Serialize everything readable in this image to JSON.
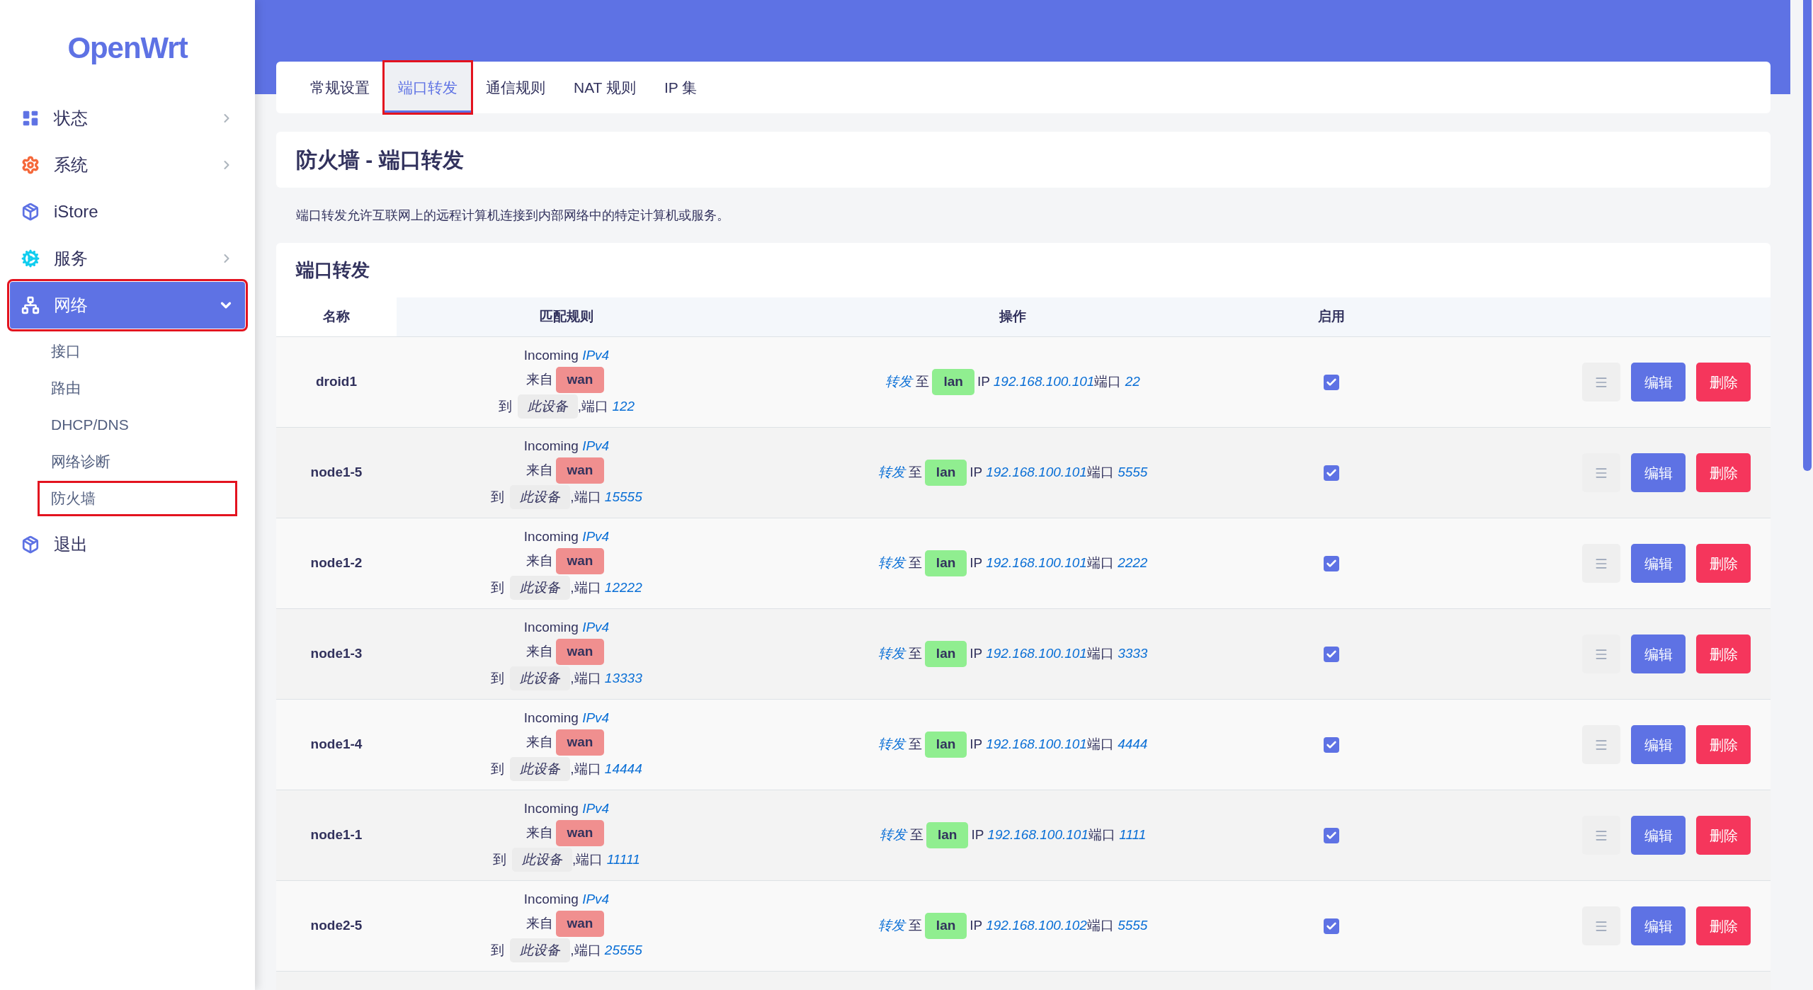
{
  "logo": "OpenWrt",
  "sidebar": {
    "items": [
      {
        "label": "状态",
        "has_arrow": true,
        "expanded": false,
        "selected": false,
        "annotated": false
      },
      {
        "label": "系统",
        "has_arrow": true,
        "expanded": false,
        "selected": false,
        "annotated": false
      },
      {
        "label": "iStore",
        "has_arrow": false,
        "selected": false,
        "annotated": false
      },
      {
        "label": "服务",
        "has_arrow": true,
        "expanded": false,
        "selected": false,
        "annotated": false
      },
      {
        "label": "网络",
        "has_arrow": true,
        "expanded": true,
        "selected": true,
        "annotated": true,
        "children": [
          {
            "label": "接口",
            "annotated": false
          },
          {
            "label": "路由",
            "annotated": false
          },
          {
            "label": "DHCP/DNS",
            "annotated": false
          },
          {
            "label": "网络诊断",
            "annotated": false
          },
          {
            "label": "防火墙",
            "annotated": true
          }
        ]
      },
      {
        "label": "退出",
        "has_arrow": false,
        "selected": false,
        "annotated": false
      }
    ]
  },
  "tabs": [
    {
      "label": "常规设置",
      "selected": false,
      "annotated": false
    },
    {
      "label": "端口转发",
      "selected": true,
      "annotated": true
    },
    {
      "label": "通信规则",
      "selected": false,
      "annotated": false
    },
    {
      "label": "NAT 规则",
      "selected": false,
      "annotated": false
    },
    {
      "label": "IP 集",
      "selected": false,
      "annotated": false
    }
  ],
  "page_title": "防火墙 - 端口转发",
  "description": "端口转发允许互联网上的远程计算机连接到内部网络中的特定计算机或服务。",
  "section": {
    "title": "端口转发",
    "table": {
      "columns": [
        "名称",
        "匹配规则",
        "操作",
        "启用"
      ],
      "rows": [
        {
          "kind": "full",
          "name": "droid1",
          "incoming": "Incoming",
          "family": "IPv4",
          "from_label": "来自",
          "zone_from": {
            "label": "wan",
            "color": "#f08f8f"
          },
          "to_label": "到",
          "dest_device": "此设备",
          "port_label": ",端口",
          "port": "122",
          "action": "转发",
          "to_word": "至",
          "zone_to": {
            "label": "lan",
            "color": "#90ee90"
          },
          "ip_label": "IP",
          "ip": "192.168.100.101",
          "dest_port_label": "端口",
          "dest_port": "22",
          "enabled": true,
          "edit": "编辑",
          "delete": "删除"
        },
        {
          "kind": "full",
          "name": "node1-5",
          "incoming": "Incoming",
          "family": "IPv4",
          "from_label": "来自",
          "zone_from": {
            "label": "wan",
            "color": "#f08f8f"
          },
          "to_label": "到",
          "dest_device": "此设备",
          "port_label": ",端口",
          "port": "15555",
          "action": "转发",
          "to_word": "至",
          "zone_to": {
            "label": "lan",
            "color": "#90ee90"
          },
          "ip_label": "IP",
          "ip": "192.168.100.101",
          "dest_port_label": "端口",
          "dest_port": "5555",
          "enabled": true,
          "edit": "编辑",
          "delete": "删除"
        },
        {
          "kind": "full",
          "name": "node1-2",
          "incoming": "Incoming",
          "family": "IPv4",
          "from_label": "来自",
          "zone_from": {
            "label": "wan",
            "color": "#f08f8f"
          },
          "to_label": "到",
          "dest_device": "此设备",
          "port_label": ",端口",
          "port": "12222",
          "action": "转发",
          "to_word": "至",
          "zone_to": {
            "label": "lan",
            "color": "#90ee90"
          },
          "ip_label": "IP",
          "ip": "192.168.100.101",
          "dest_port_label": "端口",
          "dest_port": "2222",
          "enabled": true,
          "edit": "编辑",
          "delete": "删除"
        },
        {
          "kind": "full",
          "name": "node1-3",
          "incoming": "Incoming",
          "family": "IPv4",
          "from_label": "来自",
          "zone_from": {
            "label": "wan",
            "color": "#f08f8f"
          },
          "to_label": "到",
          "dest_device": "此设备",
          "port_label": ",端口",
          "port": "13333",
          "action": "转发",
          "to_word": "至",
          "zone_to": {
            "label": "lan",
            "color": "#90ee90"
          },
          "ip_label": "IP",
          "ip": "192.168.100.101",
          "dest_port_label": "端口",
          "dest_port": "3333",
          "enabled": true,
          "edit": "编辑",
          "delete": "删除"
        },
        {
          "kind": "full",
          "name": "node1-4",
          "incoming": "Incoming",
          "family": "IPv4",
          "from_label": "来自",
          "zone_from": {
            "label": "wan",
            "color": "#f08f8f"
          },
          "to_label": "到",
          "dest_device": "此设备",
          "port_label": ",端口",
          "port": "14444",
          "action": "转发",
          "to_word": "至",
          "zone_to": {
            "label": "lan",
            "color": "#90ee90"
          },
          "ip_label": "IP",
          "ip": "192.168.100.101",
          "dest_port_label": "端口",
          "dest_port": "4444",
          "enabled": true,
          "edit": "编辑",
          "delete": "删除"
        },
        {
          "kind": "full",
          "name": "node1-1",
          "incoming": "Incoming",
          "family": "IPv4",
          "from_label": "来自",
          "zone_from": {
            "label": "wan",
            "color": "#f08f8f"
          },
          "to_label": "到",
          "dest_device": "此设备",
          "port_label": ",端口",
          "port": "11111",
          "action": "转发",
          "to_word": "至",
          "zone_to": {
            "label": "lan",
            "color": "#90ee90"
          },
          "ip_label": "IP",
          "ip": "192.168.100.101",
          "dest_port_label": "端口",
          "dest_port": "1111",
          "enabled": true,
          "edit": "编辑",
          "delete": "删除"
        },
        {
          "kind": "full",
          "name": "node2-5",
          "incoming": "Incoming",
          "family": "IPv4",
          "from_label": "来自",
          "zone_from": {
            "label": "wan",
            "color": "#f08f8f"
          },
          "to_label": "到",
          "dest_device": "此设备",
          "port_label": ",端口",
          "port": "25555",
          "action": "转发",
          "to_word": "至",
          "zone_to": {
            "label": "lan",
            "color": "#90ee90"
          },
          "ip_label": "IP",
          "ip": "192.168.100.102",
          "dest_port_label": "端口",
          "dest_port": "5555",
          "enabled": true,
          "edit": "编辑",
          "delete": "删除"
        },
        {
          "kind": "partial"
        }
      ]
    }
  }
}
